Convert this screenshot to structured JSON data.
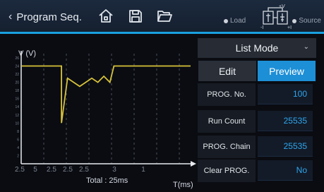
{
  "header": {
    "title": "Program Seq.",
    "back_icon": "chevron-left-icon",
    "home_icon": "home-icon",
    "save_icon": "save-icon",
    "folder_icon": "folder-open-icon",
    "load_label": "Load",
    "source_label": "Source",
    "circuit_top": "+V",
    "circuit_left": "-I",
    "circuit_right": "+I"
  },
  "chart": {
    "y_title": "V (V)",
    "x_title": "T(ms)",
    "total_label": "Total : 25ms"
  },
  "chart_data": {
    "type": "line",
    "ylabel": "V (V)",
    "xlabel": "T(ms)",
    "ylim": [
      0,
      26
    ],
    "y_ticks": [
      "2",
      "4",
      "6",
      "8",
      "10",
      "12",
      "14",
      "16",
      "18",
      "20",
      "22",
      "24",
      "26"
    ],
    "x_ticks": [
      "2.5",
      "5",
      "2.5",
      "2.5",
      "2.5",
      "3",
      "1"
    ],
    "series": [
      {
        "values": [
          [
            0,
            24
          ],
          [
            1.0,
            24
          ],
          [
            1.0,
            10
          ],
          [
            1.15,
            21
          ],
          [
            1.45,
            19
          ],
          [
            1.75,
            21
          ],
          [
            1.9,
            20
          ],
          [
            2.05,
            21.5
          ],
          [
            2.2,
            20
          ],
          [
            2.3,
            24
          ],
          [
            4.2,
            24
          ]
        ]
      }
    ]
  },
  "panel": {
    "mode": "List Mode",
    "tab_edit": "Edit",
    "tab_preview": "Preview",
    "fields": [
      {
        "label": "PROG. No.",
        "value": "100"
      },
      {
        "label": "Run Count",
        "value": "25535"
      },
      {
        "label": "PROG. Chain",
        "value": "25535"
      },
      {
        "label": "Clear PROG.",
        "value": "No"
      }
    ]
  },
  "colors": {
    "accent": "#1aa0e0",
    "trace": "#d8c23a",
    "value_text": "#2ea6ee",
    "background": "#0a0c12"
  }
}
